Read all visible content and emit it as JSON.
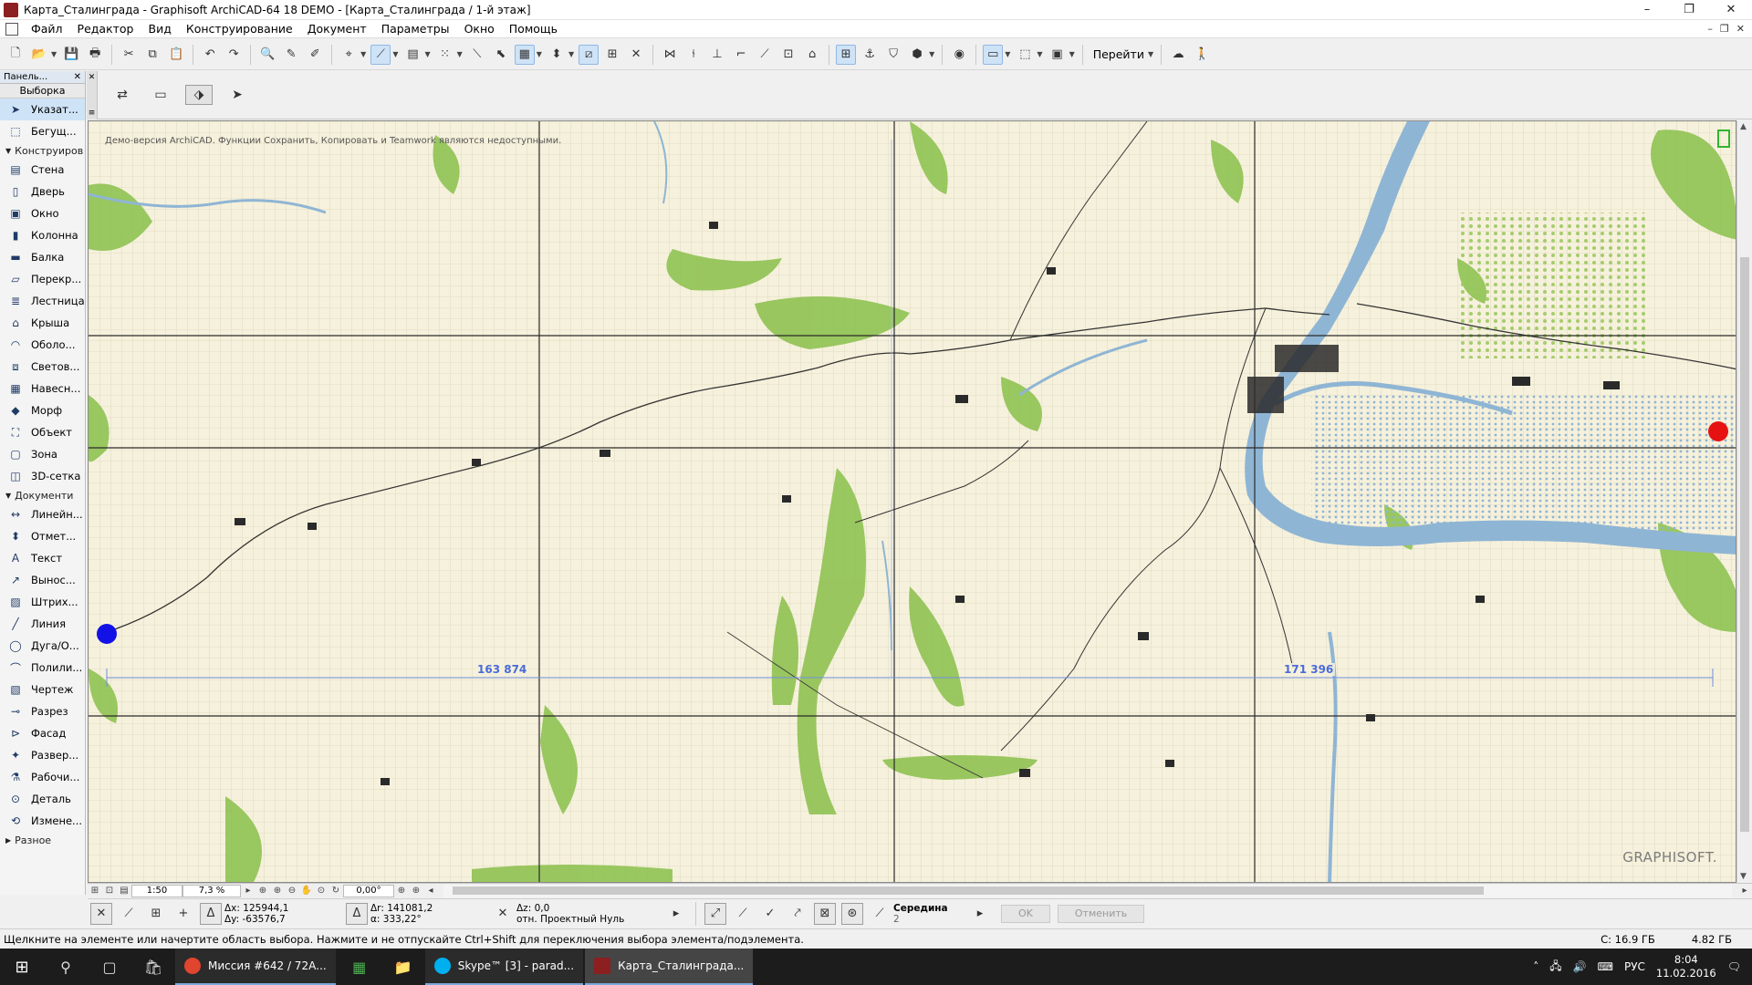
{
  "window": {
    "title": "Карта_Сталинграда - Graphisoft ArchiCAD-64 18 DEMO - [Карта_Сталинграда / 1-й этаж]",
    "controls": [
      "–",
      "❐",
      "✕"
    ]
  },
  "menu": {
    "items": [
      "Файл",
      "Редактор",
      "Вид",
      "Конструирование",
      "Документ",
      "Параметры",
      "Окно",
      "Помощь"
    ],
    "mdi_controls": [
      "–",
      "❐",
      "✕"
    ]
  },
  "toolbar": {
    "goto_label": "Перейти"
  },
  "toolbox": {
    "header": "Панель...",
    "select_title": "Выборка",
    "top_tools": [
      {
        "label": "Указат...",
        "icon": "arrow-pointer-icon",
        "selected": true
      },
      {
        "label": "Бегущ...",
        "icon": "marquee-icon",
        "selected": false
      }
    ],
    "groups": [
      {
        "label": "Конструиров",
        "tools": [
          {
            "label": "Стена",
            "icon": "wall-icon"
          },
          {
            "label": "Дверь",
            "icon": "door-icon"
          },
          {
            "label": "Окно",
            "icon": "window-icon"
          },
          {
            "label": "Колонна",
            "icon": "column-icon"
          },
          {
            "label": "Балка",
            "icon": "beam-icon"
          },
          {
            "label": "Перекр...",
            "icon": "slab-icon"
          },
          {
            "label": "Лестница",
            "icon": "stair-icon"
          },
          {
            "label": "Крыша",
            "icon": "roof-icon"
          },
          {
            "label": "Оболо...",
            "icon": "shell-icon"
          },
          {
            "label": "Светов...",
            "icon": "skylight-icon"
          },
          {
            "label": "Навесн...",
            "icon": "curtain-wall-icon"
          },
          {
            "label": "Морф",
            "icon": "morph-icon"
          },
          {
            "label": "Объект",
            "icon": "object-icon"
          },
          {
            "label": "Зона",
            "icon": "zone-icon"
          },
          {
            "label": "3D-сетка",
            "icon": "mesh-icon"
          }
        ]
      },
      {
        "label": "Документи",
        "tools": [
          {
            "label": "Линейн...",
            "icon": "dimension-icon"
          },
          {
            "label": "Отмет...",
            "icon": "level-dimension-icon"
          },
          {
            "label": "Текст",
            "icon": "text-icon"
          },
          {
            "label": "Вынос...",
            "icon": "label-icon"
          },
          {
            "label": "Штрих...",
            "icon": "fill-icon"
          },
          {
            "label": "Линия",
            "icon": "line-icon"
          },
          {
            "label": "Дуга/О...",
            "icon": "arc-icon"
          },
          {
            "label": "Полили...",
            "icon": "polyline-icon"
          },
          {
            "label": "Чертеж",
            "icon": "drawing-icon"
          },
          {
            "label": "Разрез",
            "icon": "section-icon"
          },
          {
            "label": "Фасад",
            "icon": "elevation-icon"
          },
          {
            "label": "Развер...",
            "icon": "interior-elevation-icon"
          },
          {
            "label": "Рабочи...",
            "icon": "worksheet-icon"
          },
          {
            "label": "Деталь",
            "icon": "detail-icon"
          },
          {
            "label": "Измене...",
            "icon": "change-icon"
          }
        ]
      }
    ],
    "collapsed_group": "Разное"
  },
  "viewport": {
    "demo_note": "Демо-версия ArchiCAD. Функции Сохранить, Копировать и Teamwork являются недоступными.",
    "dim_labels": [
      "163 874",
      "171 396"
    ],
    "brand": "GRAPHISOFT.",
    "water_color": "#8fb5d4",
    "vegetation_color": "#8fc252",
    "grid_color": "#333333",
    "marker_start_color": "#1212e6",
    "marker_end_color": "#e61212"
  },
  "hbar": {
    "scale": "1:50",
    "zoom": "7,3 %",
    "angle": "0,00°"
  },
  "coords": {
    "dx": "Δx: 125944,1",
    "dy": "Δy: -63576,7",
    "dr": "Δr: 141081,2",
    "angle": "α: 333,22°",
    "dz": "Δz: 0,0",
    "ref": "отн. Проектный Нуль",
    "snap_label": "Середина",
    "snap_value": "2",
    "ok": "OK",
    "cancel": "Отменить"
  },
  "status": {
    "message": "Щелкните на элементе или начертите область выбора. Нажмите и не отпускайте Ctrl+Shift для переключения выбора элемента/подэлемента.",
    "disk_c": "C: 16.9 ГБ",
    "ram": "4.82 ГБ"
  },
  "taskbar": {
    "apps": [
      {
        "label": "Миссия #642 / 72А...",
        "color": "#e0452f"
      },
      {
        "label": "Skype™ [3] - parad...",
        "color": "#00aff0"
      },
      {
        "label": "Карта_Сталинграда...",
        "color": "#8c1f1f"
      }
    ],
    "lang": "РУС",
    "time": "8:04",
    "date": "11.02.2016"
  }
}
